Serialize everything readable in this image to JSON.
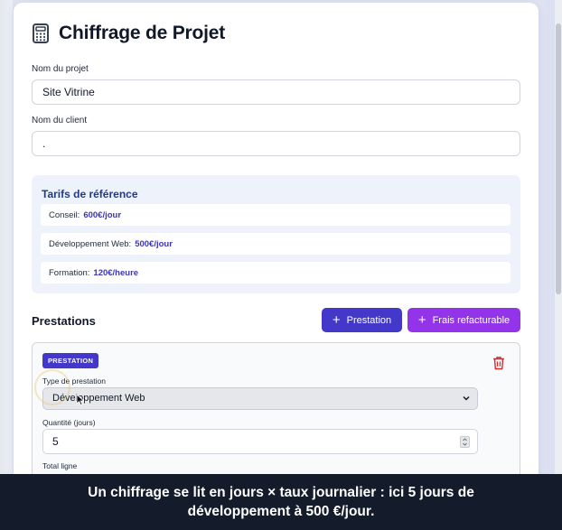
{
  "header": {
    "title": "Chiffrage de Projet",
    "icon": "calculator-icon"
  },
  "form": {
    "project_label": "Nom du projet",
    "project_value": "Site Vitrine",
    "client_label": "Nom du client",
    "client_value": "."
  },
  "rates": {
    "title": "Tarifs de référence",
    "items": [
      {
        "label": "Conseil:",
        "price": "600€/jour"
      },
      {
        "label": "Développement Web:",
        "price": "500€/jour"
      },
      {
        "label": "Formation:",
        "price": "120€/heure"
      }
    ]
  },
  "prestations": {
    "title": "Prestations",
    "add_prestation_label": "Prestation",
    "add_frais_label": "Frais refacturable",
    "item": {
      "badge": "PRESTATION",
      "type_label": "Type de prestation",
      "type_value": "Développement Web",
      "qty_label": "Quantité (jours)",
      "qty_value": "5",
      "total_label": "Total ligne"
    }
  },
  "caption": {
    "line1": "Un chiffrage se lit en jours × taux journalier : ici 5 jours de",
    "line2": "développement à 500 €/jour."
  },
  "colors": {
    "primary": "#4338ca",
    "accent": "#9333ea",
    "danger": "#dc2626",
    "rate_price": "#3b35b8",
    "rates_bg": "#eef2fb"
  }
}
